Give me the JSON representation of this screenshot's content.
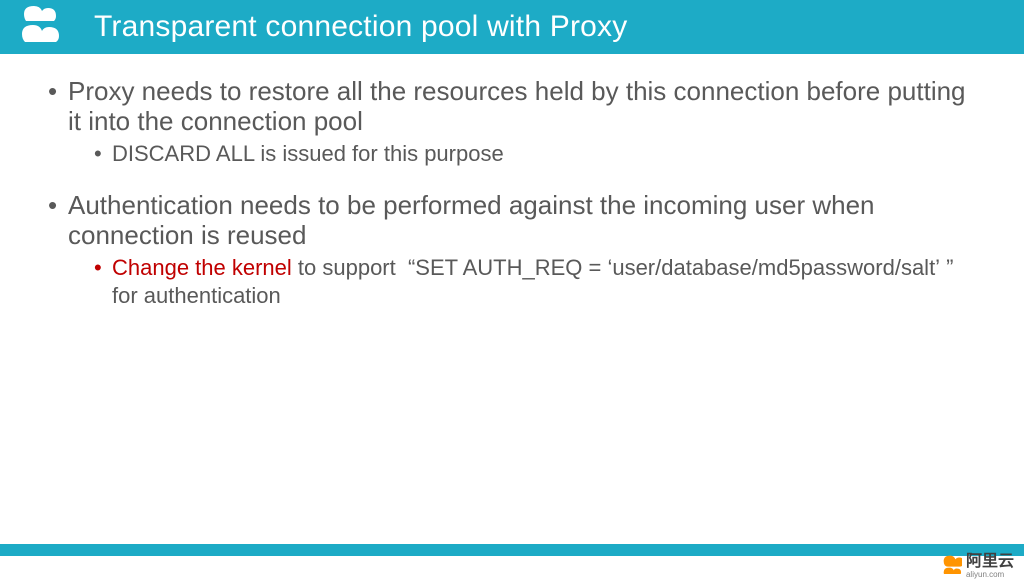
{
  "header": {
    "title": "Transparent connection pool with Proxy"
  },
  "bullets": [
    {
      "text": "Proxy needs to restore all the resources held by this connection before putting it into the connection pool",
      "sub": [
        {
          "highlight": "",
          "rest": "DISCARD ALL is issued for this purpose",
          "hl_color": ""
        }
      ]
    },
    {
      "text": "Authentication needs to be performed against the incoming user when connection is reused",
      "sub": [
        {
          "highlight": "Change the kernel ",
          "rest": "to support  “SET AUTH_REQ = ‘user/database/md5password/salt’ ”  for authentication",
          "hl_color": "red"
        }
      ]
    }
  ],
  "brand": {
    "cn": "阿里云",
    "url": "aliyun.com"
  },
  "colors": {
    "accent": "#1dabc6",
    "highlight": "#c00000",
    "body_text": "#595959"
  }
}
